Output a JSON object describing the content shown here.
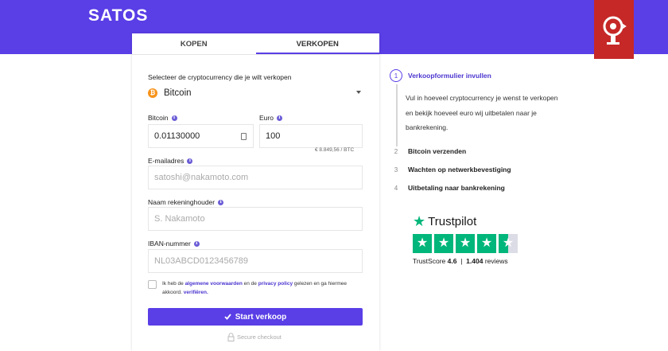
{
  "brand": {
    "logo": "SATOS"
  },
  "tabs": [
    {
      "label": "KOPEN",
      "active": false
    },
    {
      "label": "VERKOPEN",
      "active": true
    }
  ],
  "form": {
    "crypto_label": "Selecteer de cryptocurrency die je wilt verkopen",
    "crypto_selected": "Bitcoin",
    "bitcoin_label": "Bitcoin",
    "bitcoin_value": "0.01130000",
    "euro_label": "Euro",
    "euro_value": "100",
    "rate": "€ 8.849,56 / BTC",
    "email_label": "E-mailadres",
    "email_placeholder": "satoshi@nakamoto.com",
    "holder_label": "Naam rekeninghouder",
    "holder_placeholder": "S. Nakamoto",
    "iban_label": "IBAN-nummer",
    "iban_placeholder": "NL03ABCD0123456789",
    "terms_1": "Ik heb de",
    "terms_link_1": "algemene voorwaarden",
    "terms_2": "en de",
    "terms_link_2": "privacy policy",
    "terms_3": "gelezen en ga hiermee akkoord.",
    "terms_link_3": "verifiëren.",
    "submit_label": "Start verkoop",
    "secure_label": "Secure checkout"
  },
  "steps": [
    {
      "num": "1",
      "label": "Verkoopformulier invullen",
      "active": true
    },
    {
      "num": "2",
      "label": "Bitcoin verzenden",
      "active": false
    },
    {
      "num": "3",
      "label": "Wachten op netwerkbevestiging",
      "active": false
    },
    {
      "num": "4",
      "label": "Uitbetaling naar bankrekening",
      "active": false
    }
  ],
  "step1_description": "Vul in hoeveel cryptocurrency je wenst te verkopen en bekijk hoeveel euro wij uitbetalen naar je bankrekening.",
  "trustpilot": {
    "name": "Trustpilot",
    "score_label": "TrustScore",
    "score": "4.6",
    "separator": "|",
    "reviews_count": "1.404",
    "reviews_label": "reviews",
    "stars": 4.6
  },
  "colors": {
    "accent": "#5a3ee6",
    "badge": "#c62828",
    "trustpilot_green": "#00b67a",
    "bitcoin": "#f7931a"
  },
  "icons": {
    "badge": "bitcoin-logo-icon",
    "bitcoin": "bitcoin-icon",
    "info": "info-icon",
    "calculator": "calculator-icon",
    "caret": "chevron-down-icon",
    "check": "check-icon",
    "lock": "lock-icon",
    "star": "star-icon"
  }
}
